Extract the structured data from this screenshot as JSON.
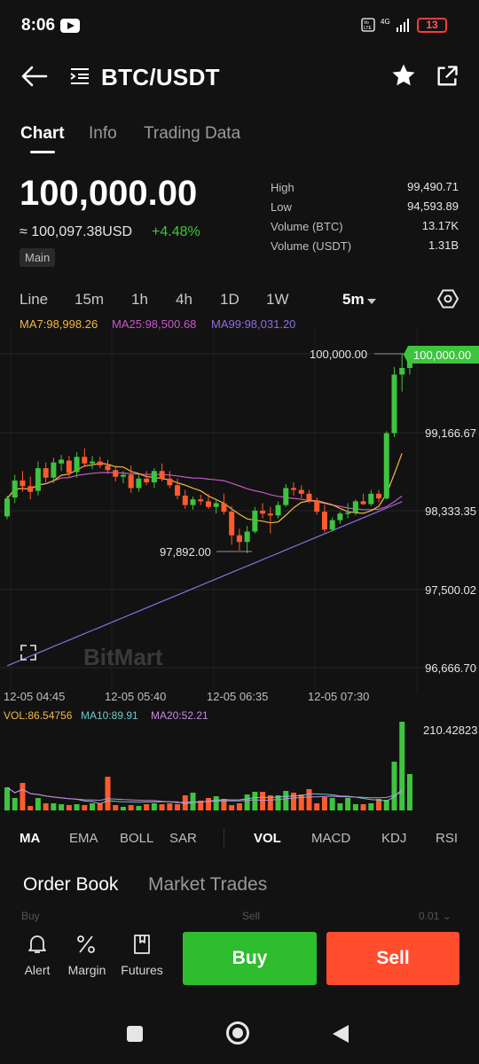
{
  "status": {
    "time": "8:06",
    "net": "4G",
    "battery": "13"
  },
  "header": {
    "pair": "BTC/USDT"
  },
  "tabs": [
    "Chart",
    "Info",
    "Trading Data"
  ],
  "ticker": {
    "price": "100,000.00",
    "approx": "≈ 100,097.38USD",
    "change": "+4.48%",
    "badge": "Main",
    "stats": [
      {
        "label": "High",
        "value": "99,490.71"
      },
      {
        "label": "Low",
        "value": "94,593.89"
      },
      {
        "label": "Volume (BTC)",
        "value": "13.17K"
      },
      {
        "label": "Volume (USDT)",
        "value": "1.31B"
      }
    ]
  },
  "intervals": {
    "items": [
      "Line",
      "15m",
      "1h",
      "4h",
      "1D",
      "1W"
    ],
    "selected": "5m"
  },
  "ma": {
    "ma7": "MA7:98,998.26",
    "ma25": "MA25:98,500.68",
    "ma99": "MA99:98,031.20"
  },
  "colors": {
    "up": "#3ec43e",
    "down": "#ff5b2e",
    "ma7": "#f5b941",
    "ma25": "#c955c9",
    "ma99": "#8f6de0"
  },
  "chart": {
    "watermark": "BitMart",
    "last_label": "100,000.00",
    "high_label": "100,000.00",
    "low_label": "97,892.00",
    "y_ticks": [
      "99,166.67",
      "98,333.35",
      "97,500.02",
      "96,666.70"
    ],
    "x_ticks": [
      "12-05 04:45",
      "12-05 05:40",
      "12-05 06:35",
      "12-05 07:30"
    ]
  },
  "volume": {
    "vol": "VOL:86.54756",
    "ma10": "MA10:89.91",
    "ma20": "MA20:52.21",
    "max_label": "210.42823"
  },
  "indicators": {
    "main": [
      "MA",
      "EMA",
      "BOLL",
      "SAR"
    ],
    "sub": [
      "VOL",
      "MACD",
      "KDJ",
      "RSI"
    ]
  },
  "orderbook": {
    "tabs": [
      "Order Book",
      "Market Trades"
    ],
    "cut_left": "Buy",
    "cut_mid": "Sell",
    "cut_right": "0.01 ⌄"
  },
  "bottom": {
    "actions": [
      "Alert",
      "Margin",
      "Futures"
    ],
    "buy": "Buy",
    "sell": "Sell"
  },
  "chart_data": {
    "type": "candlestick",
    "x_axis_labels": [
      "12-05 04:45",
      "12-05 05:40",
      "12-05 06:35",
      "12-05 07:30"
    ],
    "y_axis_labels": [
      "100,000.00",
      "99,166.67",
      "98,333.35",
      "97,500.02",
      "96,666.70"
    ],
    "ylim": [
      96600,
      100100
    ],
    "candles": [
      [
        98280,
        98500,
        98250,
        98470
      ],
      [
        98480,
        98720,
        98420,
        98660
      ],
      [
        98660,
        98760,
        98540,
        98600
      ],
      [
        98600,
        98700,
        98460,
        98540
      ],
      [
        98550,
        98860,
        98500,
        98790
      ],
      [
        98790,
        98850,
        98640,
        98690
      ],
      [
        98690,
        98900,
        98630,
        98850
      ],
      [
        98840,
        98930,
        98760,
        98880
      ],
      [
        98870,
        98920,
        98700,
        98740
      ],
      [
        98750,
        98960,
        98690,
        98910
      ],
      [
        98910,
        99000,
        98800,
        98840
      ],
      [
        98840,
        98920,
        98780,
        98860
      ],
      [
        98860,
        98910,
        98790,
        98820
      ],
      [
        98820,
        98880,
        98730,
        98770
      ],
      [
        98770,
        98800,
        98650,
        98700
      ],
      [
        98700,
        98760,
        98630,
        98720
      ],
      [
        98720,
        98820,
        98530,
        98580
      ],
      [
        98580,
        98720,
        98540,
        98680
      ],
      [
        98680,
        98760,
        98610,
        98640
      ],
      [
        98640,
        98790,
        98580,
        98760
      ],
      [
        98760,
        98840,
        98650,
        98680
      ],
      [
        98680,
        98760,
        98580,
        98610
      ],
      [
        98610,
        98680,
        98460,
        98500
      ],
      [
        98500,
        98560,
        98360,
        98400
      ],
      [
        98400,
        98490,
        98350,
        98460
      ],
      [
        98460,
        98510,
        98400,
        98440
      ],
      [
        98440,
        98520,
        98360,
        98380
      ],
      [
        98380,
        98460,
        98310,
        98420
      ],
      [
        98420,
        98520,
        98300,
        98330
      ],
      [
        98330,
        98390,
        97980,
        98080
      ],
      [
        98080,
        98150,
        97920,
        98010
      ],
      [
        98010,
        98180,
        97892,
        98120
      ],
      [
        98120,
        98380,
        98100,
        98340
      ],
      [
        98340,
        98420,
        98260,
        98310
      ],
      [
        98310,
        98380,
        98100,
        98290
      ],
      [
        98290,
        98440,
        98260,
        98400
      ],
      [
        98400,
        98620,
        98380,
        98580
      ],
      [
        98580,
        98640,
        98500,
        98560
      ],
      [
        98560,
        98610,
        98470,
        98520
      ],
      [
        98520,
        98560,
        98420,
        98450
      ],
      [
        98450,
        98480,
        98300,
        98330
      ],
      [
        98330,
        98400,
        98110,
        98140
      ],
      [
        98140,
        98270,
        98120,
        98240
      ],
      [
        98240,
        98330,
        98200,
        98310
      ],
      [
        98310,
        98420,
        98260,
        98320
      ],
      [
        98320,
        98460,
        98290,
        98440
      ],
      [
        98440,
        98520,
        98400,
        98410
      ],
      [
        98410,
        98560,
        98390,
        98520
      ],
      [
        98520,
        98560,
        98430,
        98470
      ],
      [
        98470,
        99180,
        98460,
        99160
      ],
      [
        99160,
        99860,
        99120,
        99780
      ],
      [
        99780,
        100000,
        99600,
        99850
      ],
      [
        99850,
        100000,
        99780,
        100000
      ]
    ],
    "volumes": [
      26,
      14,
      31,
      5,
      14,
      8,
      8,
      7,
      6,
      7,
      6,
      8,
      8,
      38,
      6,
      4,
      6,
      5,
      7,
      8,
      7,
      8,
      7,
      17,
      20,
      11,
      14,
      16,
      13,
      6,
      8,
      18,
      21,
      21,
      17,
      17,
      22,
      20,
      18,
      24,
      8,
      15,
      14,
      8,
      14,
      7,
      7,
      8,
      13,
      12,
      55,
      100,
      41
    ]
  }
}
